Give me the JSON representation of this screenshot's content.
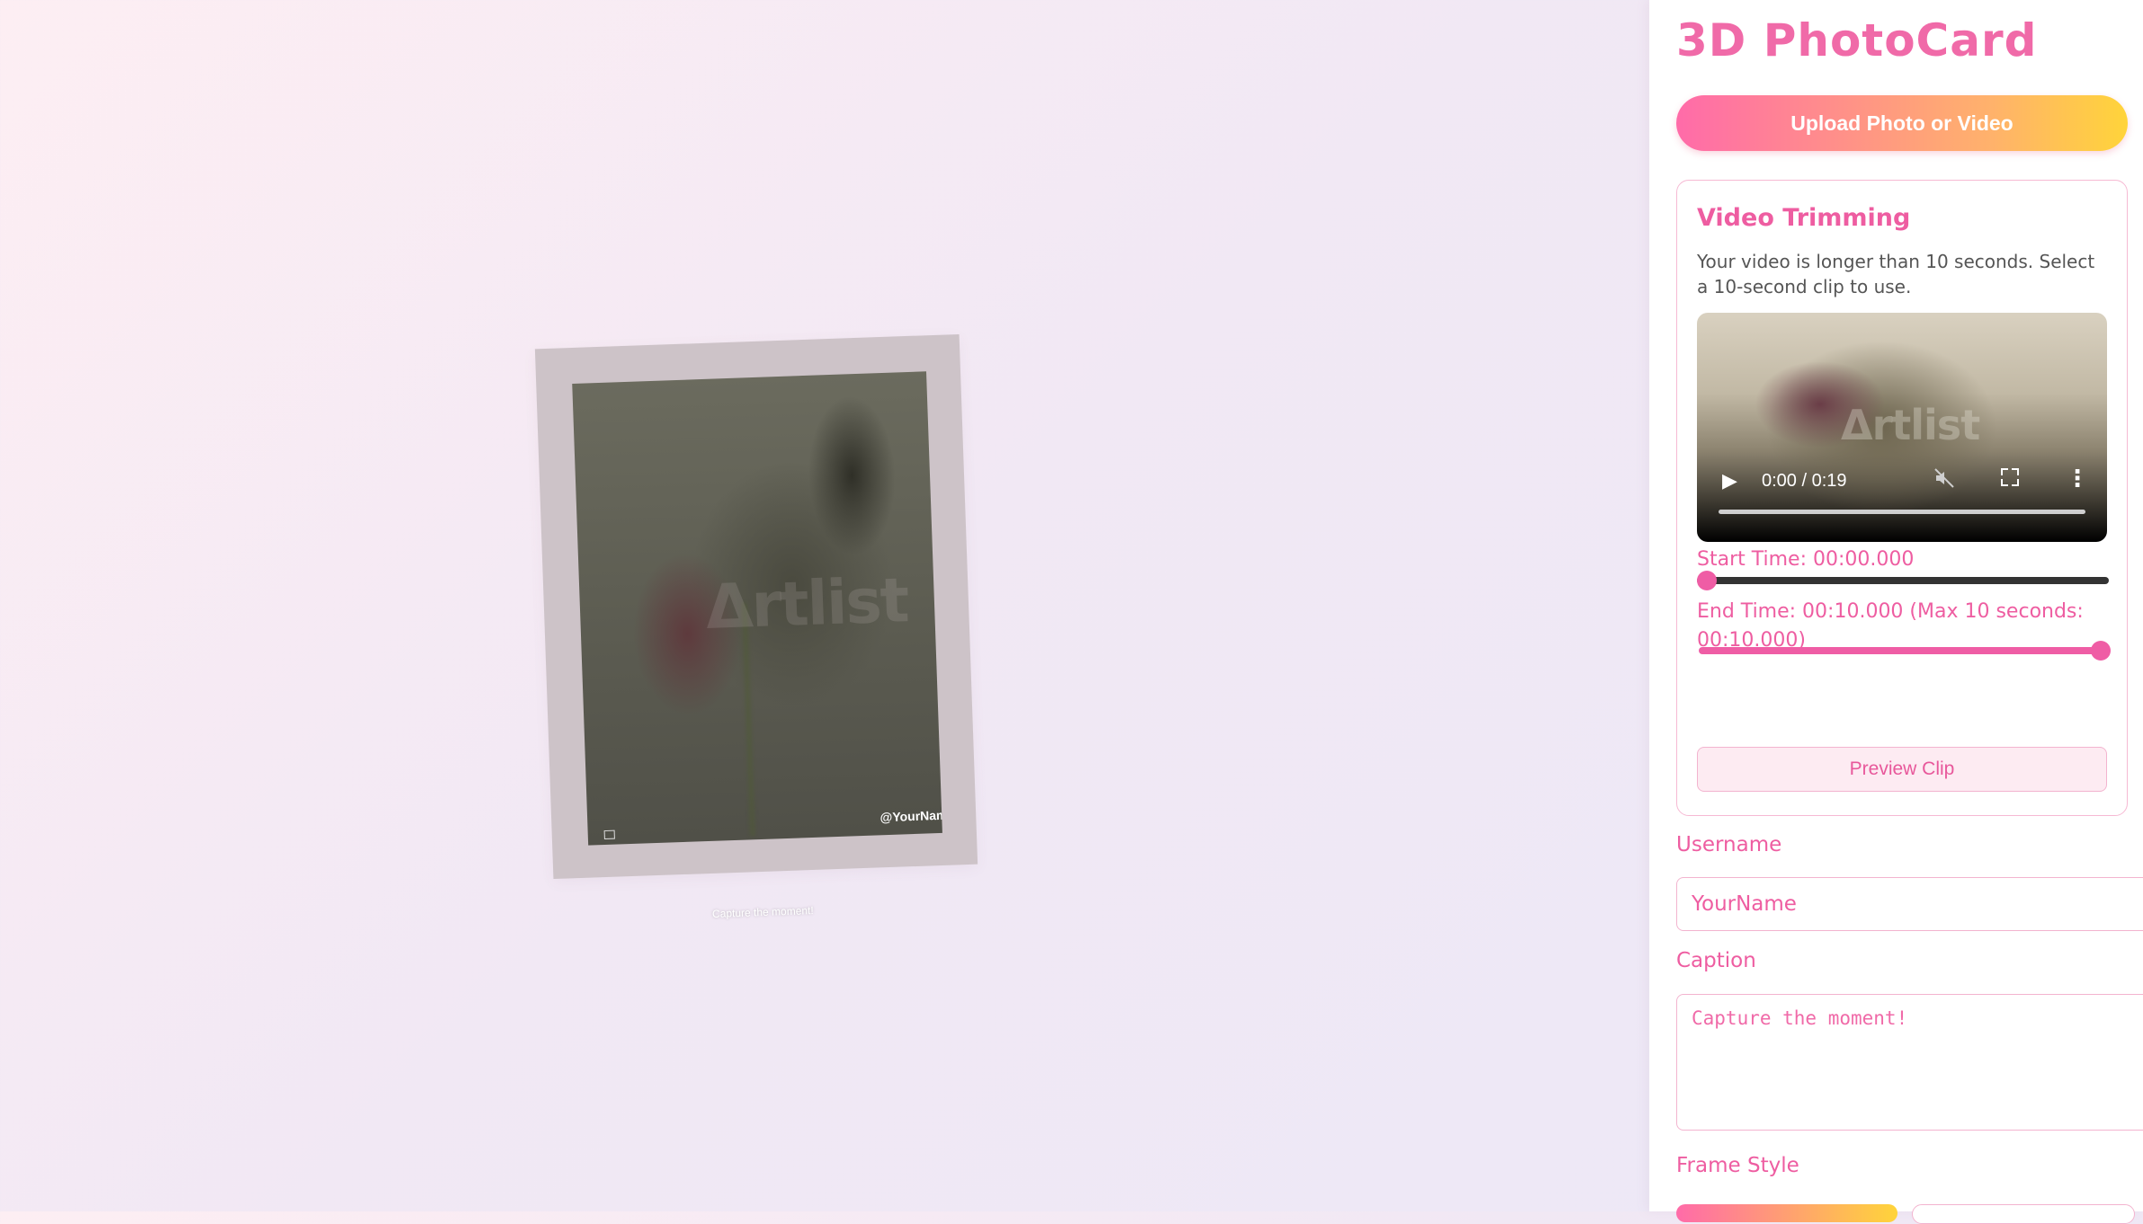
{
  "stage": {
    "card": {
      "username_overlay": "@YourName",
      "caption": "Capture the moment!",
      "watermark": "Δrtlist"
    }
  },
  "panel": {
    "title": "3D PhotoCard",
    "upload_label": "Upload Photo or Video",
    "trimming": {
      "title": "Video Trimming",
      "description": "Your video is longer than 10 seconds. Select a 10-second clip to use.",
      "video": {
        "watermark": "Δrtlist",
        "time_display": "0:00 / 0:19",
        "progress": 0
      },
      "start_label": "Start Time: 00:00.000",
      "start_value": 0,
      "end_label": "End Time: 00:10.000 (Max 10 seconds: 00:10.000)",
      "end_value": 10,
      "duration": 19,
      "preview_label": "Preview Clip"
    },
    "username": {
      "label": "Username",
      "value": "YourName"
    },
    "caption": {
      "label": "Caption",
      "placeholder": "Capture the moment!"
    },
    "frame_style": {
      "label": "Frame Style"
    }
  },
  "colors": {
    "accent": "#ee5da1",
    "gradient_start": "#ff6ba9",
    "gradient_end": "#ffd43a"
  },
  "icons": {
    "play": "play-icon",
    "mute": "muted-speaker-icon",
    "fullscreen": "fullscreen-icon",
    "more": "more-vertical-icon"
  }
}
